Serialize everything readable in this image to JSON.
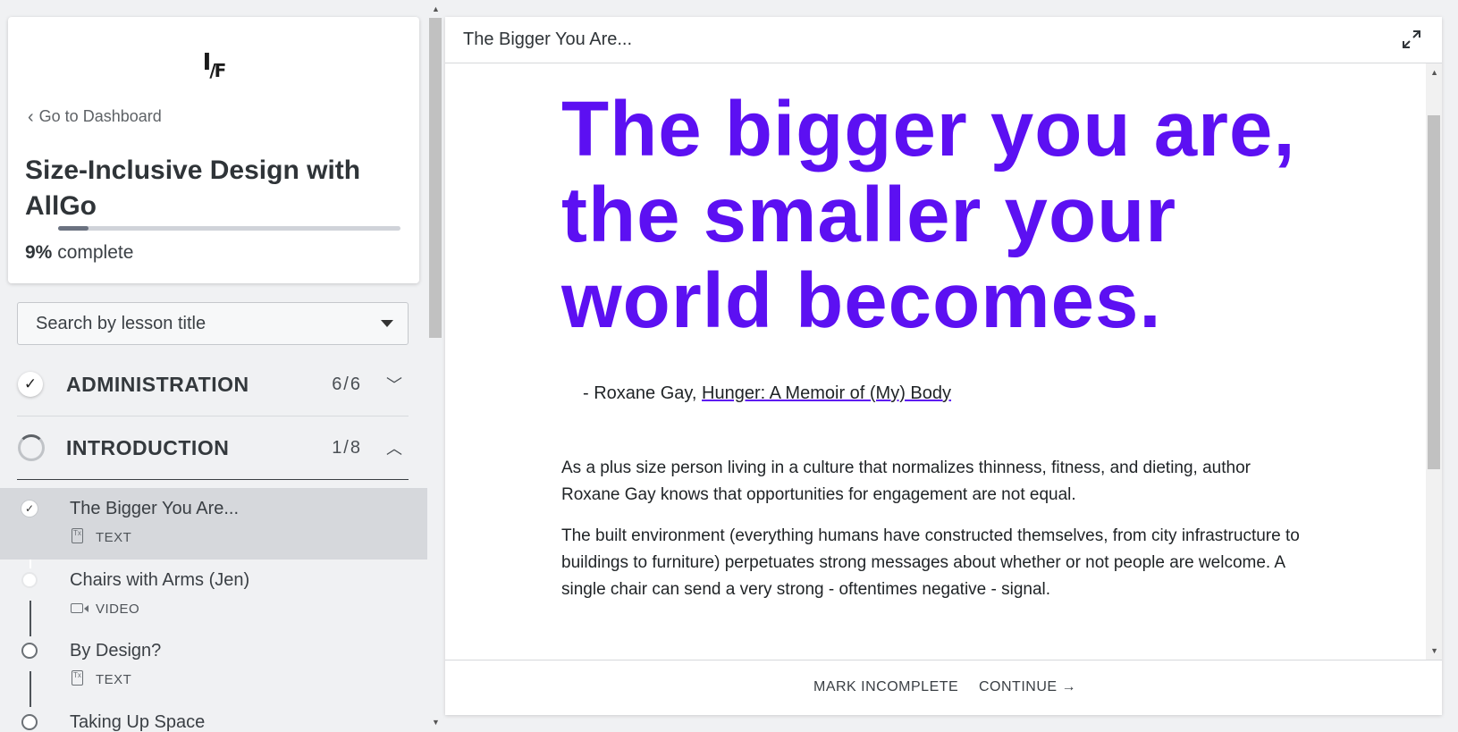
{
  "sidebar": {
    "logo_text": "I/F",
    "back_link": "Go to Dashboard",
    "course_title": "Size-Inclusive Design with AllGo",
    "progress_percent": 9,
    "progress_pct_label": "9%",
    "progress_suffix": "complete",
    "search_placeholder": "Search by lesson title",
    "sections": [
      {
        "title": "ADMINISTRATION",
        "count": "6/6",
        "status": "complete",
        "expanded": false
      },
      {
        "title": "INTRODUCTION",
        "count": "1/8",
        "status": "in-progress",
        "expanded": true
      }
    ],
    "lessons": [
      {
        "title": "The Bigger You Are...",
        "kind": "TEXT",
        "icon": "text-doc-icon",
        "status": "complete",
        "active": true
      },
      {
        "title": "Chairs with Arms (Jen)",
        "kind": "VIDEO",
        "icon": "video-camera-icon",
        "status": "incomplete",
        "active": false
      },
      {
        "title": "By Design?",
        "kind": "TEXT",
        "icon": "text-doc-icon",
        "status": "incomplete",
        "active": false
      },
      {
        "title": "Taking Up Space",
        "kind": "",
        "icon": "",
        "status": "incomplete",
        "active": false
      }
    ]
  },
  "main": {
    "header_title": "The Bigger You Are...",
    "quote": "The bigger you are, the smaller your world becomes.",
    "attribution_prefix": "- Roxane Gay, ",
    "attribution_link": "Hunger: A Memoir of (My) Body",
    "paragraphs": [
      "As a plus size person living in a culture that normalizes thinness, fitness, and dieting, author Roxane Gay knows that opportunities for engagement are not equal.",
      "The built environment (everything humans have constructed themselves, from city infrastructure to buildings to furniture) perpetuates strong messages about whether or not people are welcome. A single chair can send a very strong - oftentimes negative - signal."
    ],
    "footer": {
      "mark_incomplete": "MARK INCOMPLETE",
      "continue": "CONTINUE →"
    }
  },
  "colors": {
    "accent_purple": "#5c10f2",
    "active_lesson_bg": "#d6d8dc",
    "page_bg": "#f0f1f3"
  }
}
